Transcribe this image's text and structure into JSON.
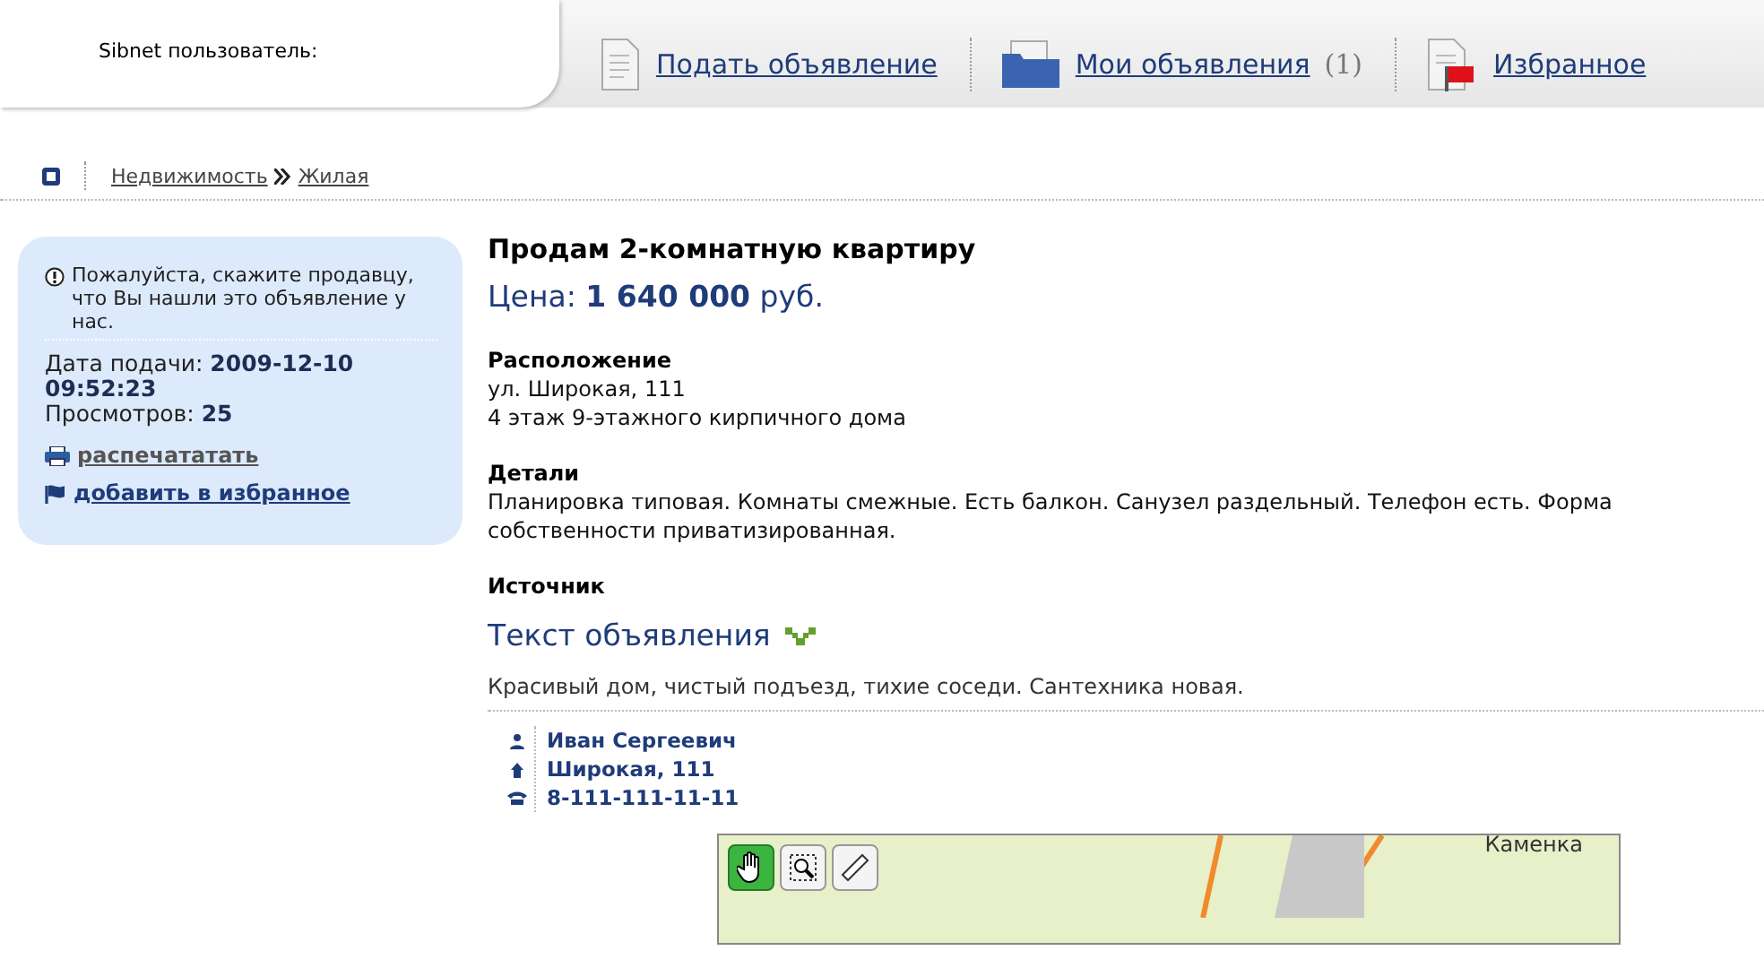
{
  "header": {
    "user_label": "Sibnet пользователь:",
    "nav": [
      {
        "kind": "post",
        "label": "Подать объявление"
      },
      {
        "kind": "mine",
        "label": "Мои объявления",
        "count": "(1)"
      },
      {
        "kind": "favorites",
        "label": "Избранное"
      }
    ]
  },
  "breadcrumb": [
    "Недвижимость",
    "Жилая"
  ],
  "sidebar": {
    "notice": "Пожалуйста, скажите продавцу, что Вы нашли это объявление у нас.",
    "date_label": "Дата подачи:",
    "date": "2009-12-10 09:52:23",
    "views_label": "Просмотров:",
    "views": "25",
    "print_link": "распечататать",
    "favorite_link": "добавить в избранное"
  },
  "ad": {
    "title": "Продам 2-комнатную квартиру",
    "price_label": "Цена:",
    "price": "1 640 000",
    "currency": "руб.",
    "sections": [
      {
        "heading": "Расположение",
        "lines": [
          "ул. Широкая, 111",
          "4 этаж 9-этажного кирпичного дома"
        ]
      },
      {
        "heading": "Детали",
        "lines": [
          "Планировка типовая. Комнаты смежные. Есть балкон. Санузел раздельный. Телефон есть. Форма собственности приватизированная."
        ]
      },
      {
        "heading": "Источник"
      }
    ],
    "text_heading": "Текст объявления",
    "text": "Красивый дом, чистый подъезд, тихие соседи. Сантехника новая.",
    "contacts": [
      {
        "kind": "person",
        "value": "Иван Сергеевич"
      },
      {
        "kind": "address",
        "value": "Широкая, 111"
      },
      {
        "kind": "phone",
        "value": "8-111-111-11-11"
      }
    ]
  },
  "map": {
    "place_label": "Каменка",
    "tools": [
      {
        "kind": "hand",
        "selected": true
      },
      {
        "kind": "zoom",
        "selected": false
      },
      {
        "kind": "ruler",
        "selected": false
      }
    ]
  }
}
